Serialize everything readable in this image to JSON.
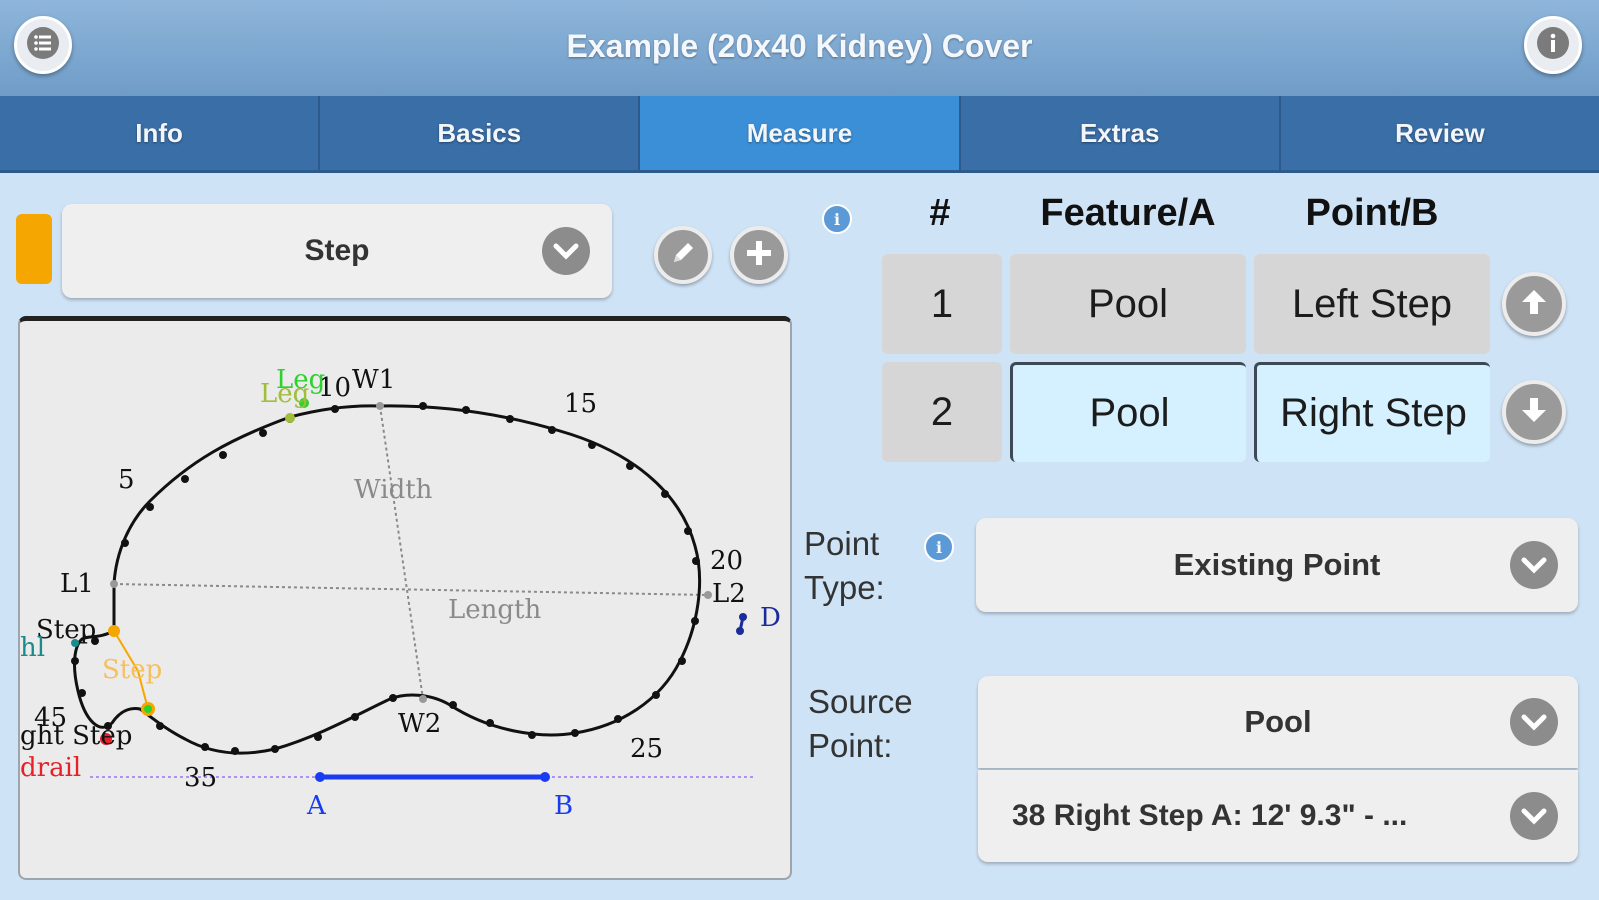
{
  "header": {
    "title": "Example (20x40 Kidney) Cover",
    "menu_icon": "list-icon",
    "info_icon": "info-icon"
  },
  "tabs": [
    {
      "label": "Info",
      "active": false
    },
    {
      "label": "Basics",
      "active": false
    },
    {
      "label": "Measure",
      "active": true
    },
    {
      "label": "Extras",
      "active": false
    },
    {
      "label": "Review",
      "active": false
    }
  ],
  "feature_select": {
    "value": "Step",
    "color": "#f5a600"
  },
  "canvas": {
    "labels": {
      "n5": "5",
      "n10": "10",
      "n15": "15",
      "n20": "20",
      "n25": "25",
      "n35": "35",
      "n45": "45",
      "w1": "W1",
      "w2": "W2",
      "l1": "L1",
      "l2": "L2",
      "width": "Width",
      "length": "Length",
      "a": "A",
      "b": "B",
      "d": "D",
      "leg1": "Leg",
      "leg2": "Leg",
      "step_left": "Step",
      "step_orange": "Step",
      "right_step": "ght Step",
      "handrail": "drail",
      "hl": "hl"
    }
  },
  "table": {
    "headers": {
      "num": "#",
      "feature": "Feature/A",
      "point": "Point/B"
    },
    "rows": [
      {
        "num": "1",
        "feature": "Pool",
        "point": "Left Step",
        "selected": false
      },
      {
        "num": "2",
        "feature": "Pool",
        "point": "Right Step",
        "selected": true
      }
    ]
  },
  "point_type": {
    "label_line1": "Point",
    "label_line2": "Type:",
    "value": "Existing Point"
  },
  "source_point": {
    "label_line1": "Source",
    "label_line2": "Point:",
    "value": "Pool",
    "detail": "38 Right Step A: 12' 9.3\"  - ..."
  }
}
